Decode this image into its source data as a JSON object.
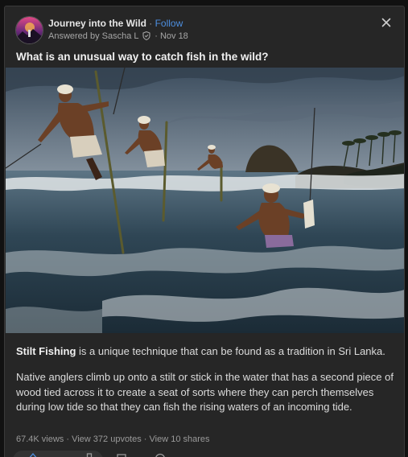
{
  "post": {
    "space_name": "Journey into the Wild",
    "separator": " · ",
    "follow_label": "Follow",
    "answered_by": "Answered by Sascha L",
    "date": " · Nov 18",
    "question": "What is an unusual way to catch fish in the wild?"
  },
  "body": {
    "lead_bold": "Stilt Fishing",
    "lead_rest": " is a unique technique that can be found as a tradition in Sri Lanka.",
    "paragraph2": "Native anglers climb up onto a stilt or stick in the water that has a second piece of wood tied across it to create a seat of sorts where they can perch themselves during low tide so that they can fish the rising waters of an incoming tide."
  },
  "stats": {
    "views": "67.4K views",
    "upvotes": "View 372 upvotes",
    "shares": "View 10 shares",
    "sep": " · "
  },
  "icons": {
    "close": "close-icon",
    "shield": "shield-icon",
    "upvote": "upvote-icon",
    "downvote": "downvote-icon",
    "comment": "comment-icon",
    "share": "share-icon",
    "more": "more-icon"
  },
  "colors": {
    "link": "#4d8fe0",
    "background": "#262626",
    "text": "#dcdcdc"
  }
}
